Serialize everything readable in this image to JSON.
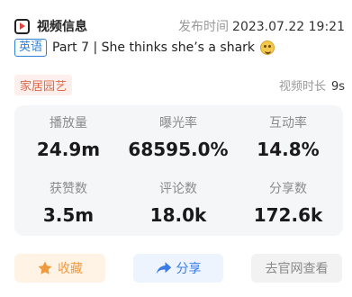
{
  "header": {
    "title": "视频信息",
    "publish_label": "发布时间",
    "publish_time": "2023.07.22 19:21"
  },
  "video": {
    "language_badge": "英语",
    "title": "Part 7 | She thinks she’s a shark",
    "category": "家居园艺",
    "duration_label": "视频时长",
    "duration": "9s"
  },
  "stats": [
    {
      "label": "播放量",
      "value": "24.9m"
    },
    {
      "label": "曝光率",
      "value": "68595.0%"
    },
    {
      "label": "互动率",
      "value": "14.8%"
    },
    {
      "label": "获赞数",
      "value": "3.5m"
    },
    {
      "label": "评论数",
      "value": "18.0k"
    },
    {
      "label": "分享数",
      "value": "172.6k"
    }
  ],
  "actions": {
    "favorite_label": "收藏",
    "share_label": "分享",
    "site_label": "去官网查看"
  },
  "colors": {
    "favorite_accent": "#f09a3e",
    "share_accent": "#3a7be6",
    "category_accent": "#e0684a",
    "badge_accent": "#2d82d8"
  }
}
